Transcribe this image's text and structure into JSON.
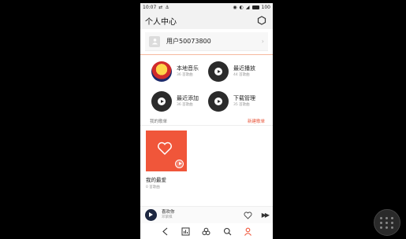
{
  "status": {
    "time": "10:07",
    "battery": "100"
  },
  "header": {
    "title": "个人中心"
  },
  "user": {
    "name": "用户50073800"
  },
  "grid": [
    {
      "name": "本地音乐",
      "count": "36 首歌曲",
      "icon": "local-music-cover"
    },
    {
      "name": "最近播放",
      "count": "44 首歌曲",
      "icon": "recent-play-disc"
    },
    {
      "name": "最近添加",
      "count": "36 首歌曲",
      "icon": "recent-add-disc"
    },
    {
      "name": "下载管理",
      "count": "35 首歌曲",
      "icon": "download-disc"
    }
  ],
  "section": {
    "label": "我的歌单",
    "new_playlist": "新建歌单"
  },
  "playlist": {
    "name": "我的最爱",
    "count": "0 首歌曲"
  },
  "now_playing": {
    "title": "喜欢你",
    "artist": "邓紫棋"
  },
  "colors": {
    "accent": "#f0563a",
    "header_bg": "#f2f2f2"
  }
}
